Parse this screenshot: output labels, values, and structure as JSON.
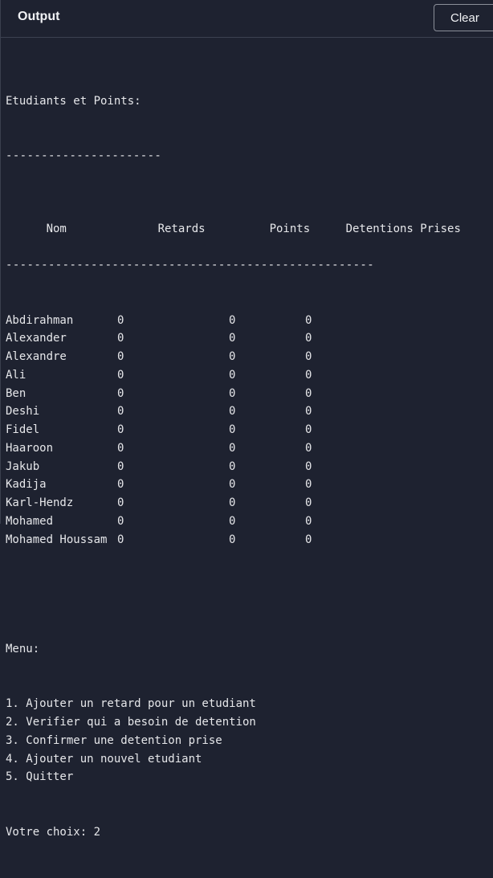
{
  "header": {
    "title": "Output",
    "clear_label": "Clear"
  },
  "console": {
    "heading": "Etudiants et Points:",
    "heading_rule": "----------------------",
    "columns": [
      "Nom",
      "Retards",
      "Points",
      "Detentions Prises"
    ],
    "table_rule": "----------------------------------------------------",
    "rows": [
      [
        "Abdirahman",
        "0",
        "0",
        "0"
      ],
      [
        "Alexander",
        "0",
        "0",
        "0"
      ],
      [
        "Alexandre",
        "0",
        "0",
        "0"
      ],
      [
        "Ali",
        "0",
        "0",
        "0"
      ],
      [
        "Ben",
        "0",
        "0",
        "0"
      ],
      [
        "Deshi",
        "0",
        "0",
        "0"
      ],
      [
        "Fidel",
        "0",
        "0",
        "0"
      ],
      [
        "Haaroon",
        "0",
        "0",
        "0"
      ],
      [
        "Jakub",
        "0",
        "0",
        "0"
      ],
      [
        "Kadija",
        "0",
        "0",
        "0"
      ],
      [
        "Karl-Hendz",
        "0",
        "0",
        "0"
      ],
      [
        "Mohamed",
        "0",
        "0",
        "0"
      ],
      [
        "Mohamed Houssam",
        "0",
        "0",
        "0"
      ]
    ],
    "menu_title": "Menu:",
    "menu_items": [
      "1. Ajouter un retard pour un etudiant",
      "2. Verifier qui a besoin de detention",
      "3. Confirmer une detention prise",
      "4. Ajouter un nouvel etudiant",
      "5. Quitter"
    ],
    "prompt": "Votre choix: 2"
  }
}
